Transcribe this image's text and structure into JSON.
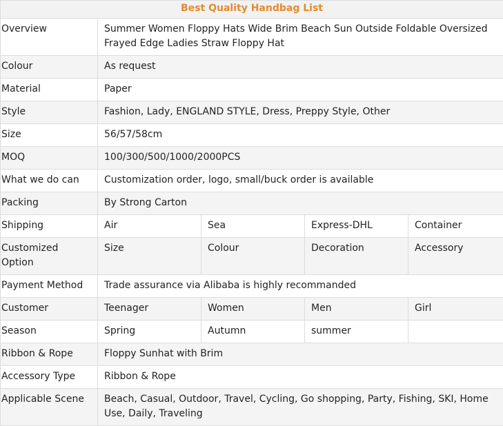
{
  "table": {
    "title": "Best Quality Handbag List",
    "rows": [
      {
        "label": "Overview",
        "value": "Summer Women Floppy Hats Wide Brim Beach Sun Outside Foldable Oversized Frayed Edge Ladies Straw Floppy Hat"
      },
      {
        "label": "Colour",
        "value": "As request"
      },
      {
        "label": "Material",
        "value": "Paper"
      },
      {
        "label": "Style",
        "value": "Fashion, Lady, ENGLAND STYLE, Dress, Preppy Style, Other"
      },
      {
        "label": "Size",
        "value": "56/57/58cm"
      },
      {
        "label": "MOQ",
        "value": "100/300/500/1000/2000PCS"
      },
      {
        "label": "What we do can",
        "value": "Customization order, logo, small/buck order is available"
      },
      {
        "label": "Packing",
        "value": "By Strong Carton"
      },
      {
        "label": "Shipping",
        "cells": [
          "Air",
          "Sea",
          "Express-DHL",
          "Container"
        ]
      },
      {
        "label": "Customized Option",
        "cells": [
          "Size",
          "Colour",
          "Decoration",
          "Accessory"
        ]
      },
      {
        "label": "Payment Method",
        "value": "Trade assurance via Alibaba is highly recommanded"
      },
      {
        "label": "Customer",
        "cells": [
          "Teenager",
          "Women",
          "Men",
          "Girl"
        ]
      },
      {
        "label": "Season",
        "cells": [
          "Spring",
          "Autumn",
          "summer",
          ""
        ]
      },
      {
        "label": "Ribbon & Rope",
        "value": "Floppy Sunhat with Brim"
      },
      {
        "label": "Accessory Type",
        "value": "Ribbon & Rope"
      },
      {
        "label": "Applicable Scene",
        "value": "Beach, Casual, Outdoor, Travel, Cycling, Go shopping, Party, Fishing, SKI, Home Use, Daily, Traveling"
      }
    ]
  }
}
